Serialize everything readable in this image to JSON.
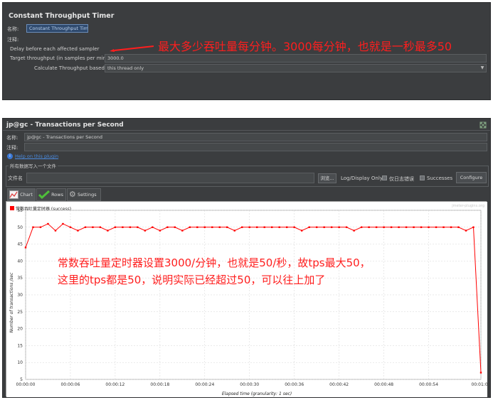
{
  "timer_panel": {
    "title": "Constant Throughput Timer",
    "name_label": "名称:",
    "name_value": "Constant Throughput Timer",
    "comment_label": "注释:",
    "delay_label": "Delay before each affected sampler",
    "target_label": "Target throughput (in samples per minute):",
    "target_value": "3000.0",
    "calc_label": "Calculate Throughput based on:",
    "calc_value": "this thread only",
    "annotation": "最大多少吞吐量每分钟。3000每分钟，也就是一秒最多50"
  },
  "listener_panel": {
    "title": "jp@gc - Transactions per Second",
    "name_label": "名称:",
    "name_value": "jp@gc - Transactions per Second",
    "comment_label": "注释:",
    "help_link": "Help on this plugin",
    "file_section_label": "所有数据写入一个文件",
    "filename_label": "文件名",
    "browse_label": "浏览...",
    "log_display_label": "Log/Display Only:",
    "errors_label": "仅日志错误",
    "successes_label": "Successes",
    "configure_label": "Configure",
    "tabs": [
      "Chart",
      "Rows",
      "Settings"
    ],
    "collapse_icon": "expand-arrows-icon"
  },
  "chart_data": {
    "type": "line",
    "legend": [
      "常数吞吐量定时器 (success)"
    ],
    "legend_placement": "top-left",
    "xlabel": "Elapsed time (granularity: 1 sec)",
    "ylabel": "Number of transactions /sec",
    "watermark": "jmeter-plugins.org",
    "ylim": [
      5,
      55
    ],
    "yticks": [
      "5",
      "10",
      "15",
      "20",
      "25",
      "30",
      "35",
      "40",
      "45",
      "50",
      "55"
    ],
    "xticks": [
      "00:00:00",
      "00:00:06",
      "00:00:12",
      "00:00:18",
      "00:00:24",
      "00:00:30",
      "00:00:36",
      "00:00:42",
      "00:00:48",
      "00:00:54",
      "00:01:01"
    ],
    "grid": true,
    "color": "#ff0000",
    "series": [
      {
        "name": "常数吞吐量定时器 (success)",
        "x": [
          0,
          1,
          2,
          3,
          4,
          5,
          6,
          7,
          8,
          9,
          10,
          11,
          12,
          13,
          14,
          15,
          16,
          17,
          18,
          19,
          20,
          21,
          22,
          23,
          24,
          25,
          26,
          27,
          28,
          29,
          30,
          31,
          32,
          33,
          34,
          35,
          36,
          37,
          38,
          39,
          40,
          41,
          42,
          43,
          44,
          45,
          46,
          47,
          48,
          49,
          50,
          51,
          52,
          53,
          54,
          55,
          56,
          57,
          58,
          59,
          60,
          61
        ],
        "y": [
          44,
          50,
          50,
          51,
          49,
          51,
          50,
          49,
          50,
          50,
          50,
          49,
          50,
          50,
          50,
          50,
          49,
          50,
          49,
          50,
          50,
          49,
          50,
          50,
          50,
          50,
          50,
          50,
          49,
          50,
          50,
          50,
          50,
          50,
          50,
          50,
          50,
          49,
          50,
          50,
          50,
          50,
          50,
          50,
          49,
          50,
          50,
          50,
          50,
          50,
          50,
          50,
          50,
          50,
          50,
          50,
          50,
          50,
          50,
          49,
          50,
          7
        ]
      }
    ],
    "annotation_line1": "常数吞吐量定时器设置3000/分钟，也就是50/秒，故tps最大50，",
    "annotation_line2": "这里的tps都是50，说明实际已经超过50，可以往上加了"
  }
}
